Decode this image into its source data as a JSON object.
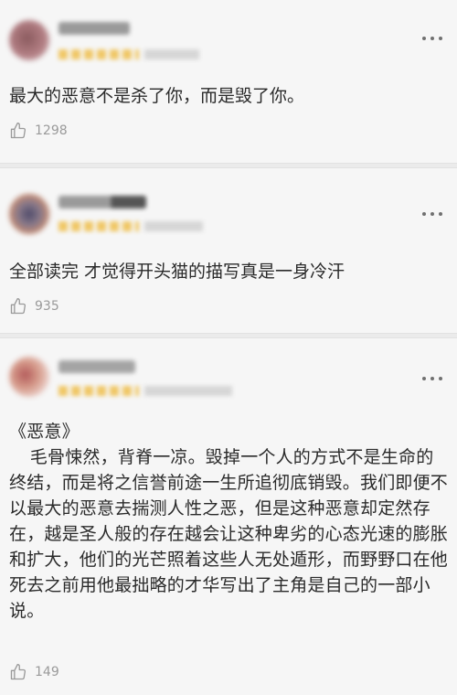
{
  "comments": [
    {
      "text": "最大的恶意不是杀了你，而是毁了你。",
      "likes": "1298",
      "avatar_color": "#8a5a5e"
    },
    {
      "text": "全部读完  才觉得开头猫的描写真是一身冷汗",
      "likes": "935",
      "avatar_color": "#7a6a8a"
    },
    {
      "title": "《恶意》",
      "paragraphs": [
        "毛骨悚然，背脊一凉。毁掉一个人的方式不是生命的终结，而是将之信誉前途一生所追彻底销毁。我们即便不以最大的恶意去揣测人性之恶，但是这种恶意却定然存在，越是圣人般的存在越会让这种卑劣的心态光速的膨胀和扩大，他们的光芒照着这些人无处遁形，而野野口在他死去之前用他最拙略的才华写出了主角是自己的一部小说。"
      ],
      "likes": "149",
      "avatar_color": "#c7a19a"
    }
  ],
  "icons": {
    "like": "thumbs-up-icon",
    "more": "more-dots-icon"
  }
}
